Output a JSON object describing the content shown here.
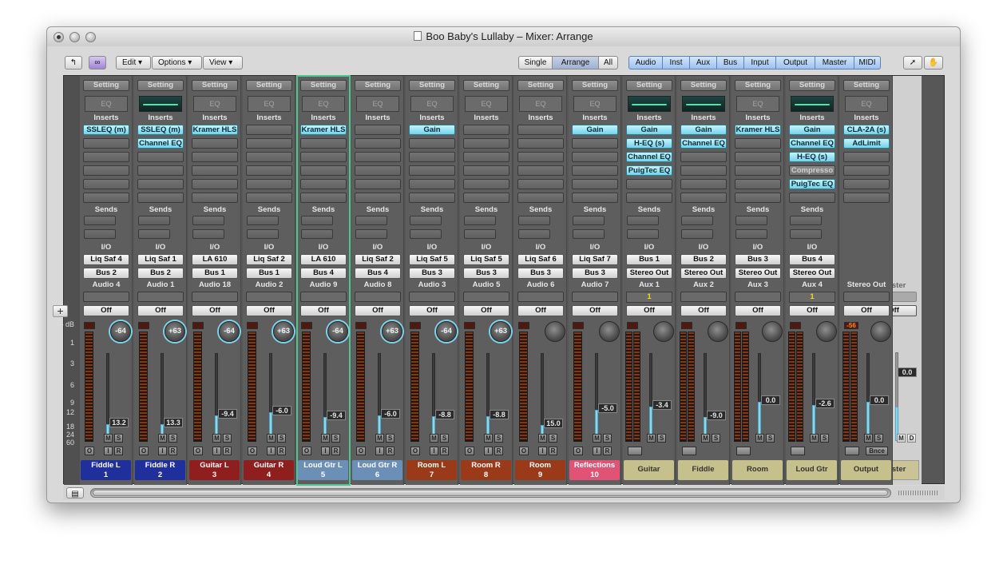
{
  "window": {
    "title": "Boo Baby's Lullaby – Mixer: Arrange"
  },
  "toolbar": {
    "menus": [
      "Edit",
      "Options",
      "View"
    ],
    "view_mode": [
      "Single",
      "Arrange",
      "All"
    ],
    "filters": [
      "Audio",
      "Inst",
      "Aux",
      "Bus",
      "Input",
      "Output",
      "Master",
      "MIDI"
    ]
  },
  "section_labels": {
    "setting": "Setting",
    "eq": "EQ",
    "inserts": "Inserts",
    "sends": "Sends",
    "io": "I/O"
  },
  "db_labels": [
    "– dB",
    "1",
    "3",
    "6",
    "9",
    "12",
    "18",
    "24",
    "60"
  ],
  "strips": [
    {
      "track": "Fiddle L",
      "num": "1",
      "color": "#1f2f9c",
      "ins": [
        "SSLEQ (m)"
      ],
      "in": "Liq Saf 4",
      "out": "Bus 2",
      "name": "Audio 4",
      "auto": "Off",
      "pan": "-64",
      "fader": "13.2",
      "level": 0.4
    },
    {
      "track": "Fiddle R",
      "num": "2",
      "color": "#1f2f9c",
      "eqcurve": true,
      "ins": [
        "SSLEQ (m)",
        "Channel EQ"
      ],
      "in": "Liq Saf 1",
      "out": "Bus 2",
      "name": "Audio 1",
      "auto": "Off",
      "pan": "+63",
      "fader": "13.3",
      "level": 0.4
    },
    {
      "track": "Guitar L",
      "num": "3",
      "color": "#8f1e1e",
      "ins": [
        "Kramer HLS"
      ],
      "in": "LA 610",
      "out": "Bus 1",
      "name": "Audio 18",
      "auto": "Off",
      "pan": "-64",
      "fader": "-9.4",
      "level": 0.6
    },
    {
      "track": "Guitar R",
      "num": "4",
      "color": "#8f1e1e",
      "ins": [],
      "in": "Liq Saf 2",
      "out": "Bus 1",
      "name": "Audio 2",
      "auto": "Off",
      "pan": "+63",
      "fader": "-6.0",
      "level": 0.66
    },
    {
      "track": "Loud Gtr L",
      "num": "5",
      "color": "#6c8fb7",
      "sel": true,
      "ins": [
        "Kramer HLS"
      ],
      "in": "LA 610",
      "out": "Bus 4",
      "name": "Audio 9",
      "auto": "Off",
      "pan": "-64",
      "fader": "-9.4",
      "level": 0.55
    },
    {
      "track": "Loud Gtr R",
      "num": "6",
      "color": "#6c8fb7",
      "ins": [],
      "in": "Liq Saf 2",
      "out": "Bus 4",
      "name": "Audio 8",
      "auto": "Off",
      "pan": "+63",
      "fader": "-6.0",
      "level": 0.6
    },
    {
      "track": "Room L",
      "num": "7",
      "color": "#9a3a18",
      "ins": [
        "Gain"
      ],
      "in": "Liq Saf 5",
      "out": "Bus 3",
      "name": "Audio 3",
      "auto": "Off",
      "pan": "-64",
      "fader": "-8.8",
      "level": 0.58
    },
    {
      "track": "Room R",
      "num": "8",
      "color": "#9a3a18",
      "ins": [],
      "in": "Liq Saf 5",
      "out": "Bus 3",
      "name": "Audio 5",
      "auto": "Off",
      "pan": "+63",
      "fader": "-8.8",
      "level": 0.58
    },
    {
      "track": "Room",
      "num": "9",
      "color": "#9a3a18",
      "ins": [],
      "in": "Liq Saf 6",
      "out": "Bus 3",
      "name": "Audio 6",
      "auto": "Off",
      "pan": "",
      "fader": "15.0",
      "level": 0.38
    },
    {
      "track": "Reflections",
      "num": "10",
      "color": "#e05376",
      "ins": [
        "Gain"
      ],
      "in": "Liq Saf 7",
      "out": "Bus 3",
      "name": "Audio 7",
      "auto": "Off",
      "pan": "",
      "fader": "-5.0",
      "level": 0.72
    },
    {
      "track": "Guitar",
      "num": "",
      "color": "#c6c08c",
      "aux": true,
      "eqcurve": true,
      "ins": [
        "Gain",
        "H-EQ (s)",
        "Channel EQ",
        "PuigTec EQ"
      ],
      "in": "Bus 1",
      "out": "Stereo Out",
      "name": "Aux 1",
      "autoval": "1",
      "auto": "Off",
      "pan": "",
      "fader": "-3.4",
      "level": 0.8
    },
    {
      "track": "Fiddle",
      "num": "",
      "color": "#c6c08c",
      "aux": true,
      "eqcurve": true,
      "ins": [
        "Gain",
        "Channel EQ"
      ],
      "in": "Bus 2",
      "out": "Stereo Out",
      "name": "Aux 2",
      "auto": "Off",
      "pan": "",
      "fader": "-9.0",
      "level": 0.55
    },
    {
      "track": "Room",
      "num": "",
      "color": "#c6c08c",
      "aux": true,
      "ins": [
        "Kramer HLS"
      ],
      "in": "Bus 3",
      "out": "Stereo Out",
      "name": "Aux 3",
      "auto": "Off",
      "pan": "",
      "fader": "0.0",
      "level": 0.9
    },
    {
      "track": "Loud Gtr",
      "num": "",
      "color": "#c6c08c",
      "aux": true,
      "eqcurve": true,
      "ins": [
        "Gain",
        "Channel EQ",
        "H-EQ (s)",
        "Compresso",
        "PuigTec EQ"
      ],
      "in": "Bus 4",
      "out": "Stereo Out",
      "name": "Aux 4",
      "autoval": "1",
      "auto": "Off",
      "pan": "",
      "fader": "-2.6",
      "level": 0.82
    },
    {
      "track": "Output",
      "num": "",
      "color": "#c6c08c",
      "output": true,
      "ins": [
        "CLA-2A (s)",
        "AdLimit"
      ],
      "name": "Stereo Out",
      "auto": "Off",
      "peak": "-56",
      "pan": "",
      "fader": "0.0",
      "level": 0.9
    }
  ],
  "master": {
    "label": "Master",
    "auto": "Off",
    "fader": "0.0",
    "level": 0.78,
    "name": "Master"
  },
  "buttons": {
    "m": "M",
    "s": "S",
    "i": "I",
    "r": "R",
    "o": "O",
    "d": "D",
    "bnce": "Bnce"
  }
}
